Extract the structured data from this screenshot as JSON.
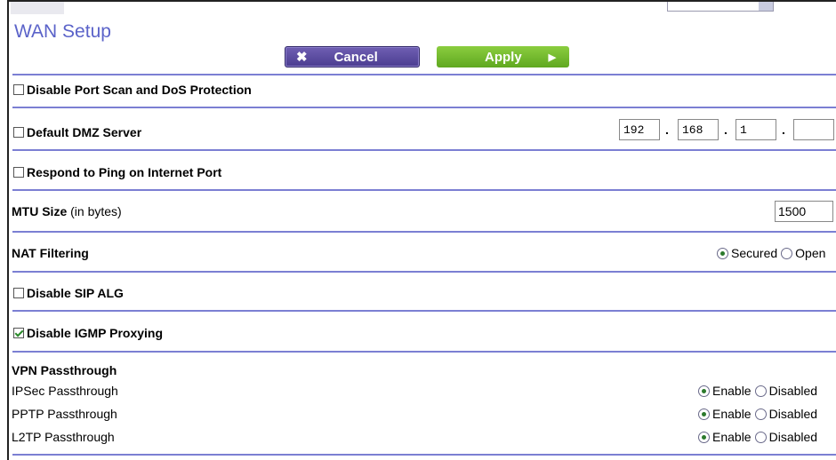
{
  "page": {
    "title": "WAN Setup"
  },
  "buttons": {
    "cancel": "Cancel",
    "apply": "Apply"
  },
  "icons": {
    "cancel": "close-icon",
    "apply": "arrow-right-icon"
  },
  "port_scan": {
    "label": "Disable Port Scan and DoS Protection",
    "checked": false
  },
  "dmz": {
    "label": "Default DMZ Server",
    "checked": false,
    "ip": [
      "192",
      "168",
      "1",
      ""
    ],
    "separator": "."
  },
  "ping": {
    "label": "Respond to Ping on Internet Port",
    "checked": false
  },
  "mtu": {
    "label": "MTU Size",
    "unit": "(in bytes)",
    "value": "1500"
  },
  "nat": {
    "label": "NAT Filtering",
    "options": [
      "Secured",
      "Open"
    ],
    "selected": "Secured"
  },
  "sip": {
    "label": "Disable SIP ALG",
    "checked": false
  },
  "igmp": {
    "label": "Disable IGMP Proxying",
    "checked": true
  },
  "vpn": {
    "heading": "VPN Passthrough",
    "option_labels": [
      "Enable",
      "Disabled"
    ],
    "items": [
      {
        "label": "IPSec Passthrough",
        "selected": "Enable"
      },
      {
        "label": "PPTP Passthrough",
        "selected": "Enable"
      },
      {
        "label": "L2TP Passthrough",
        "selected": "Enable"
      }
    ]
  },
  "colors": {
    "title": "#5b63c9",
    "separator": "#7b7fd3",
    "cancel": "#5a4ca3",
    "apply": "#72ba2e"
  }
}
